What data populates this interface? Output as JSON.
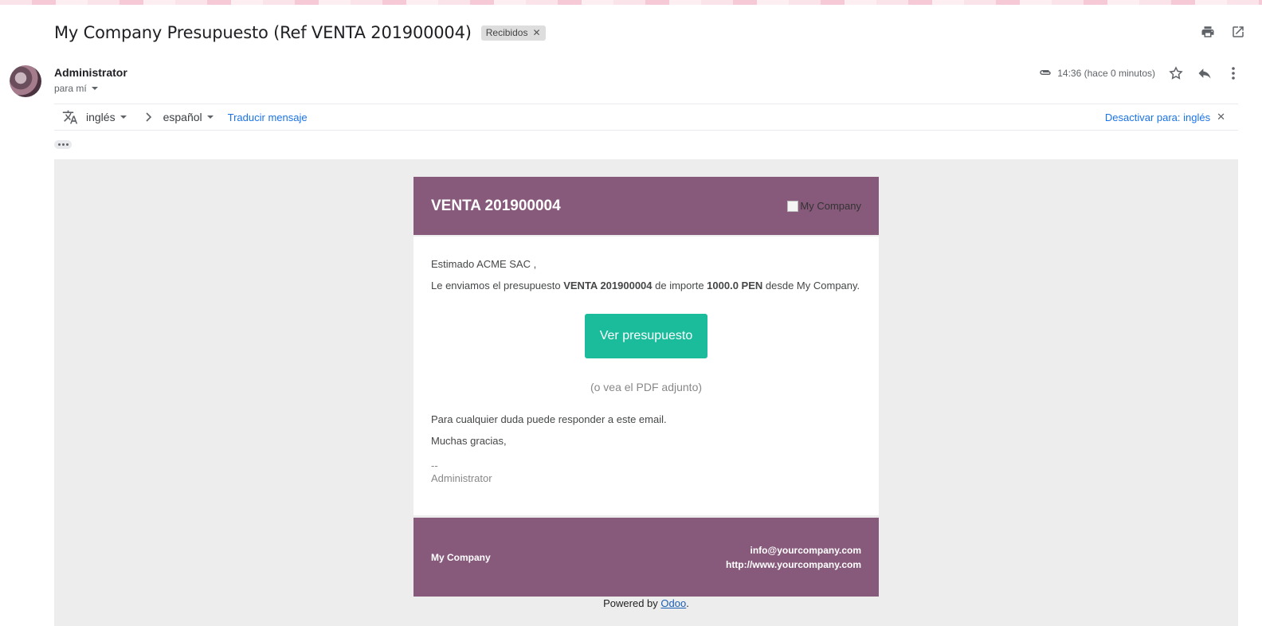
{
  "email": {
    "subject": "My Company Presupuesto (Ref VENTA 201900004)",
    "label_chip": "Recibidos",
    "sender_name": "Administrator",
    "recipient_text": "para mí",
    "timestamp": "14:36 (hace 0 minutos)"
  },
  "icons": {
    "print": "print-icon",
    "open_new_window": "open-in-new-window-icon",
    "attachment": "paperclip-icon",
    "star": "star-icon",
    "reply": "reply-icon",
    "more": "more-vert-icon",
    "translate": "translate-icon"
  },
  "translation_bar": {
    "source_language": "inglés",
    "target_language": "español",
    "translate_link": "Traducir mensaje",
    "disable_link": "Desactivar para: inglés"
  },
  "message": {
    "header_title": "VENTA 201900004",
    "logo_alt": "My Company",
    "greeting": "Estimado ACME SAC ,",
    "body_prefix": "Le enviamos el presupuesto ",
    "body_ref": "VENTA 201900004",
    "body_middle": " de importe ",
    "body_amount": "1000.0 PEN",
    "body_suffix": " desde My Company.",
    "button_label": "Ver presupuesto",
    "pdf_note": "(o vea el PDF adjunto)",
    "questions_line": "Para cualquier duda puede responder a este email.",
    "thanks_line": "Muchas gracias,",
    "signature_dash": "--",
    "signature_name": "Administrator",
    "footer_company": "My Company",
    "footer_email": "info@yourcompany.com",
    "footer_website": "http://www.yourcompany.com",
    "powered_prefix": "Powered by ",
    "powered_link": "Odoo",
    "powered_suffix": "."
  },
  "colors": {
    "brand_purple": "#875a7b",
    "button_teal": "#1abc9c",
    "link_blue": "#1a73e8"
  }
}
